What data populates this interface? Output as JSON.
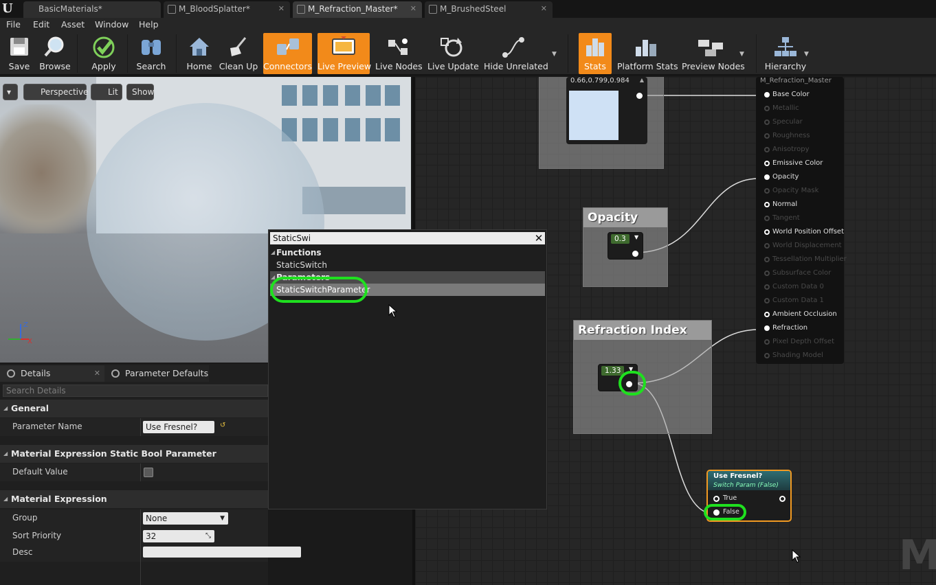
{
  "tabs": [
    {
      "label": "BasicMaterials*",
      "active": false
    },
    {
      "label": "M_BloodSplatter*",
      "active": false
    },
    {
      "label": "M_Refraction_Master*",
      "active": true
    },
    {
      "label": "M_BrushedSteel",
      "active": false
    }
  ],
  "menu": [
    "File",
    "Edit",
    "Asset",
    "Window",
    "Help"
  ],
  "toolbar": {
    "save": "Save",
    "browse": "Browse",
    "apply": "Apply",
    "search": "Search",
    "home": "Home",
    "clean_up": "Clean Up",
    "connectors": "Connectors",
    "live_preview": "Live Preview",
    "live_nodes": "Live Nodes",
    "live_update": "Live Update",
    "hide_unrelated": "Hide Unrelated",
    "stats": "Stats",
    "platform_stats": "Platform Stats",
    "preview_nodes": "Preview Nodes",
    "hierarchy": "Hierarchy",
    "active_color": "#f28a1a"
  },
  "viewport": {
    "perspective": "Perspective",
    "lit": "Lit",
    "show": "Show",
    "axis_z": "Z",
    "axis_x": "X"
  },
  "details": {
    "tab_details": "Details",
    "tab_param_defaults": "Parameter Defaults",
    "search_placeholder": "Search Details",
    "cat_general": "General",
    "param_name_label": "Parameter Name",
    "param_name_value": "Use Fresnel?",
    "cat_static_bool": "Material Expression Static Bool Parameter",
    "default_value_label": "Default Value",
    "cat_material_expression": "Material Expression",
    "group_label": "Group",
    "group_value": "None",
    "sort_priority_label": "Sort Priority",
    "sort_priority_value": "32",
    "desc_label": "Desc"
  },
  "graph": {
    "color_node_value": "0.66,0.799,0.984",
    "opacity_title": "Opacity",
    "opacity_value": "0.3",
    "refraction_title": "Refraction Index",
    "refraction_value": "1.33",
    "result_title": "M_Refraction_Master",
    "result_pins": [
      {
        "label": "Base Color",
        "active": true
      },
      {
        "label": "Metallic",
        "active": false
      },
      {
        "label": "Specular",
        "active": false
      },
      {
        "label": "Roughness",
        "active": false
      },
      {
        "label": "Anisotropy",
        "active": false
      },
      {
        "label": "Emissive Color",
        "active": true
      },
      {
        "label": "Opacity",
        "active": true
      },
      {
        "label": "Opacity Mask",
        "active": false
      },
      {
        "label": "Normal",
        "active": true
      },
      {
        "label": "Tangent",
        "active": false
      },
      {
        "label": "World Position Offset",
        "active": true
      },
      {
        "label": "World Displacement",
        "active": false
      },
      {
        "label": "Tessellation Multiplier",
        "active": false
      },
      {
        "label": "Subsurface Color",
        "active": false
      },
      {
        "label": "Custom Data 0",
        "active": false
      },
      {
        "label": "Custom Data 1",
        "active": false
      },
      {
        "label": "Ambient Occlusion",
        "active": true
      },
      {
        "label": "Refraction",
        "active": true
      },
      {
        "label": "Pixel Depth Offset",
        "active": false
      },
      {
        "label": "Shading Model",
        "active": false
      }
    ],
    "switch_title": "Use Fresnel?",
    "switch_subtitle": "Switch Param (False)",
    "switch_true": "True",
    "switch_false": "False",
    "watermark": "MA",
    "highlight_color": "#1fe01f"
  },
  "context_menu": {
    "search_value": "StaticSwi",
    "cat_functions": "Functions",
    "item_static_switch": "StaticSwitch",
    "cat_parameters": "Parameters",
    "item_static_switch_param": "StaticSwitchParameter"
  }
}
